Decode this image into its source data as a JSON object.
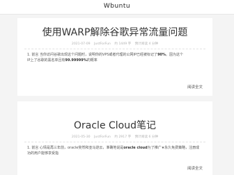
{
  "site": {
    "title": "Wbuntu"
  },
  "posts": [
    {
      "title": "使用WARP解除谷歌异常流量问题",
      "meta": {
        "date": "2021-07-09",
        "author": "JustForFun",
        "extra": "约 1449 字",
        "read_time": "预计阅读 4 分钟"
      },
      "excerpt": {
        "line1": "1. 前言 当你访问谷歌出现这个问题时，说明你的VPS或者代理的公网IP已经被标记了",
        "line1_bold": "90%",
        "line1_tail": "。因为这个",
        "line2": "IP上了谷歌的黑名单且有",
        "line2_bold": "99.99999%",
        "line2_tail": "的概率"
      },
      "read_more": "阅读全文"
    },
    {
      "title": "Oracle Cloud笔记",
      "meta": {
        "date": "2021-05-30",
        "author": "JustForFun",
        "extra": "约 2917 字",
        "read_time": "预计阅读 6 分钟"
      },
      "excerpt": {
        "line1": "1. 前言 心情是再三年前，oracle突然和亚马逊云，准确地说是",
        "line1_bold": "oracle cloud",
        "line1_tail": "为了推广★永久免费策略，注册成功的用户能够享受指",
        "line2": "",
        "line2_bold": "",
        "line2_tail": ""
      },
      "read_more": "阅读全文"
    }
  ]
}
